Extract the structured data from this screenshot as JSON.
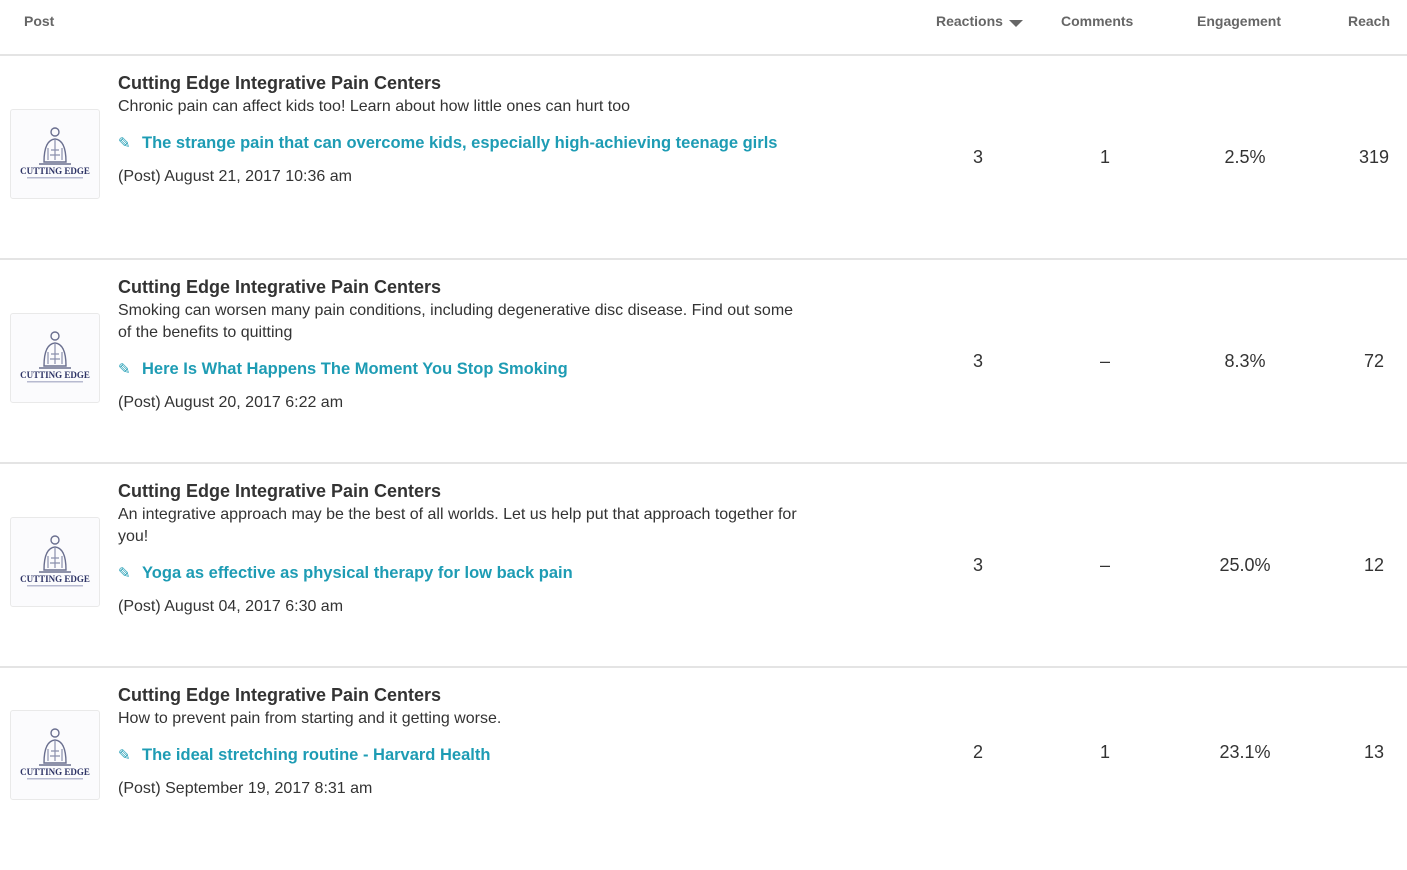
{
  "columns": {
    "post": "Post",
    "reactions": "Reactions",
    "comments": "Comments",
    "engagement": "Engagement",
    "reach": "Reach"
  },
  "sort": {
    "column": "reactions",
    "direction": "descending"
  },
  "colors": {
    "link": "#1e9cb4",
    "text": "#333333",
    "header": "#666666",
    "divider": "#e4e4e4"
  },
  "rows": [
    {
      "page_name": "Cutting Edge Integrative Pain Centers",
      "message": "Chronic pain can affect kids too! Learn about how little ones can hurt too",
      "link_icon": "link-icon",
      "link_text": "The strange pain that can overcome kids, especially high-achieving teenage girls",
      "date": "(Post) August 21, 2017 10:36 am",
      "reactions": "3",
      "comments": "1",
      "engagement": "2.5%",
      "reach": "319"
    },
    {
      "page_name": "Cutting Edge Integrative Pain Centers",
      "message": "Smoking can worsen many pain conditions, including degenerative disc disease. Find out some of the benefits to quitting",
      "link_icon": "link-icon",
      "link_text": "Here Is What Happens The Moment You Stop Smoking",
      "date": "(Post) August 20, 2017 6:22 am",
      "reactions": "3",
      "comments": "–",
      "engagement": "8.3%",
      "reach": "72"
    },
    {
      "page_name": "Cutting Edge Integrative Pain Centers",
      "message": "An integrative approach may be the best of all worlds. Let us help put that approach together for you!",
      "link_icon": "link-icon",
      "link_text": "Yoga as effective as physical therapy for low back pain",
      "date": "(Post) August 04, 2017 6:30 am",
      "reactions": "3",
      "comments": "–",
      "engagement": "25.0%",
      "reach": "12"
    },
    {
      "page_name": "Cutting Edge Integrative Pain Centers",
      "message": "How to prevent pain from starting and it getting worse.",
      "link_icon": "link-icon",
      "link_text": "The ideal stretching routine - Harvard Health",
      "date": "(Post) September 19, 2017 8:31 am",
      "reactions": "2",
      "comments": "1",
      "engagement": "23.1%",
      "reach": "13"
    }
  ],
  "avatar": {
    "logo_text": "CUTTING EDGE"
  }
}
